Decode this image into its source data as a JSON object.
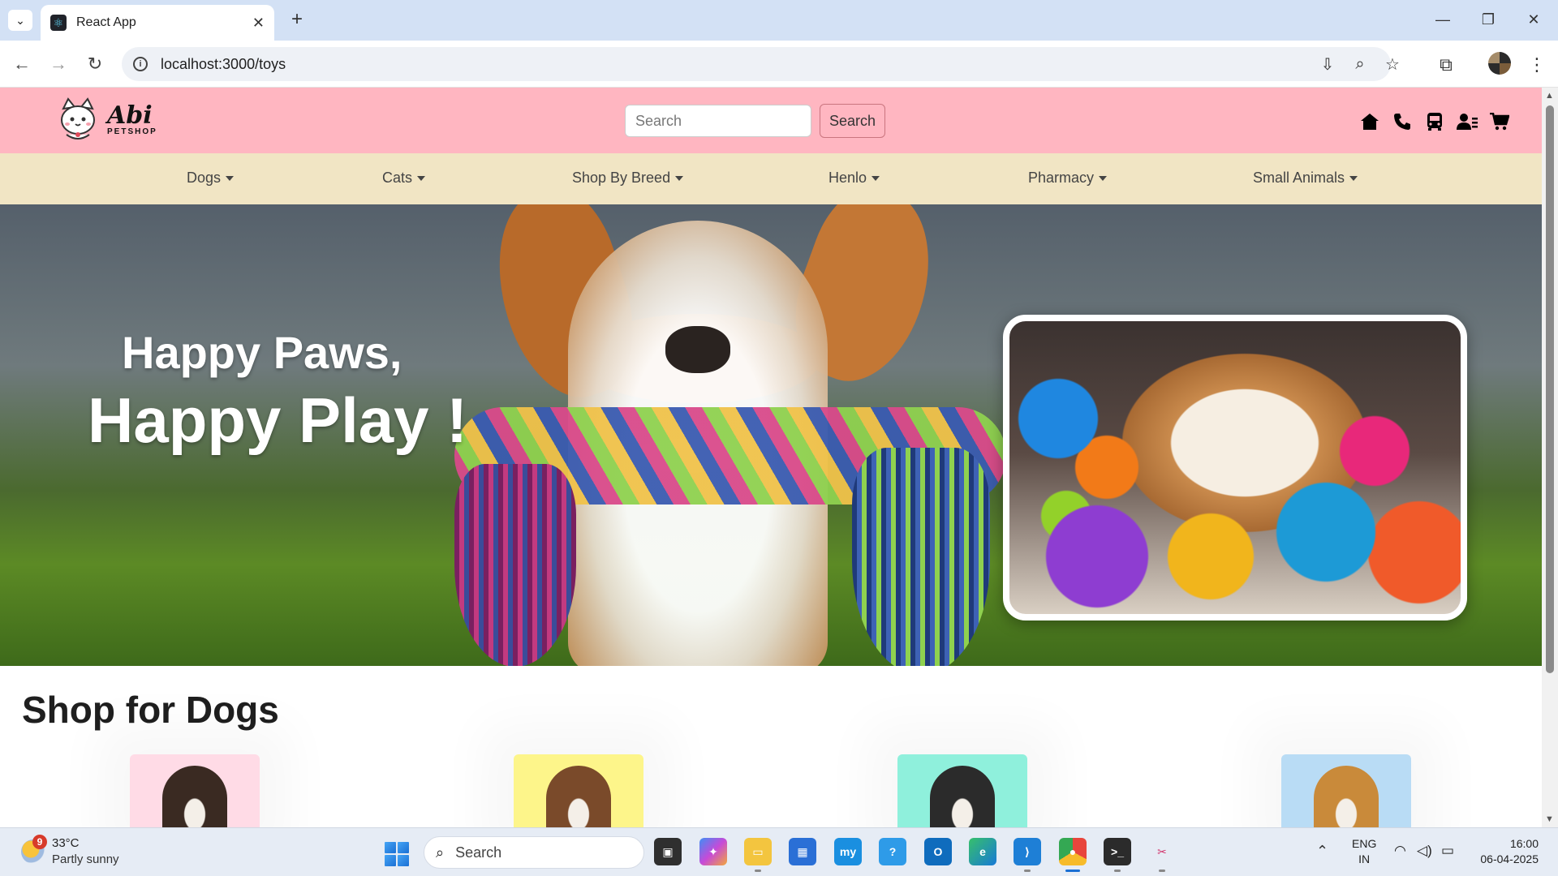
{
  "browser": {
    "tab_title": "React App",
    "url": "localhost:3000/toys"
  },
  "site": {
    "logo_name": "Abi",
    "logo_sub": "PETSHOP",
    "search_placeholder": "Search",
    "search_button": "Search",
    "nav": [
      "Dogs",
      "Cats",
      "Shop By Breed",
      "Henlo",
      "Pharmacy",
      "Small Animals"
    ],
    "hero": {
      "line1": "Happy Paws,",
      "line2": "Happy Play !"
    },
    "section_title": "Shop for Dogs",
    "cards": [
      {
        "name": "dog-card-1",
        "bg": "#ffdbe6",
        "pet": "#3a2a22"
      },
      {
        "name": "dog-card-2",
        "bg": "#fdf58a",
        "pet": "#7a4a2a"
      },
      {
        "name": "dog-card-3",
        "bg": "#8ff0dc",
        "pet": "#2b2b2b"
      },
      {
        "name": "dog-card-4",
        "bg": "#b9dcf5",
        "pet": "#c98a3a"
      }
    ]
  },
  "taskbar": {
    "weather_badge": "9",
    "weather_temp": "33°C",
    "weather_desc": "Partly sunny",
    "search": "Search",
    "lang_top": "ENG",
    "lang_bottom": "IN",
    "time": "16:00",
    "date": "06-04-2025"
  },
  "colors": {
    "header_bg": "#ffb6c1",
    "nav_bg": "#f1e5c4"
  }
}
